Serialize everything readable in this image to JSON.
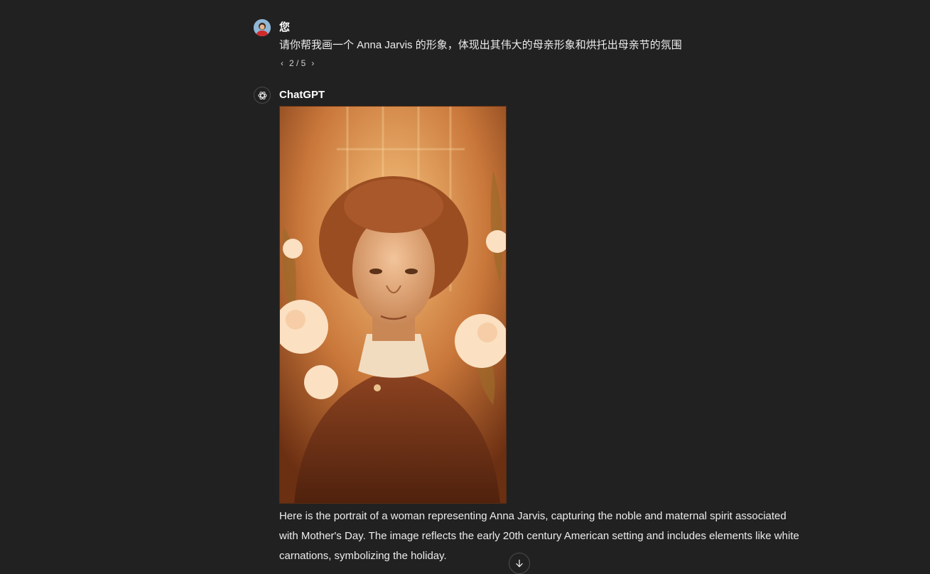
{
  "user": {
    "name": "您",
    "prompt": "请你帮我画一个 Anna Jarvis 的形象，体现出其伟大的母亲形象和烘托出母亲节的氛围",
    "pager": "2 / 5",
    "avatar_icon": "user-avatar-icon"
  },
  "assistant": {
    "name": "ChatGPT",
    "avatar_icon": "openai-logo-icon",
    "image": {
      "subject": "sepia portrait of a woman with white carnations",
      "tones": [
        "#f3b06a",
        "#b3612a",
        "#5a2810"
      ]
    },
    "reply": "Here is the portrait of a woman representing Anna Jarvis, capturing the noble and maternal spirit associated with Mother's Day. The image reflects the early 20th century American setting and includes elements like white carnations, symbolizing the holiday."
  },
  "colors": {
    "background": "#212121",
    "text": "#ececec"
  },
  "controls": {
    "scroll_down_icon": "arrow-down-icon"
  }
}
